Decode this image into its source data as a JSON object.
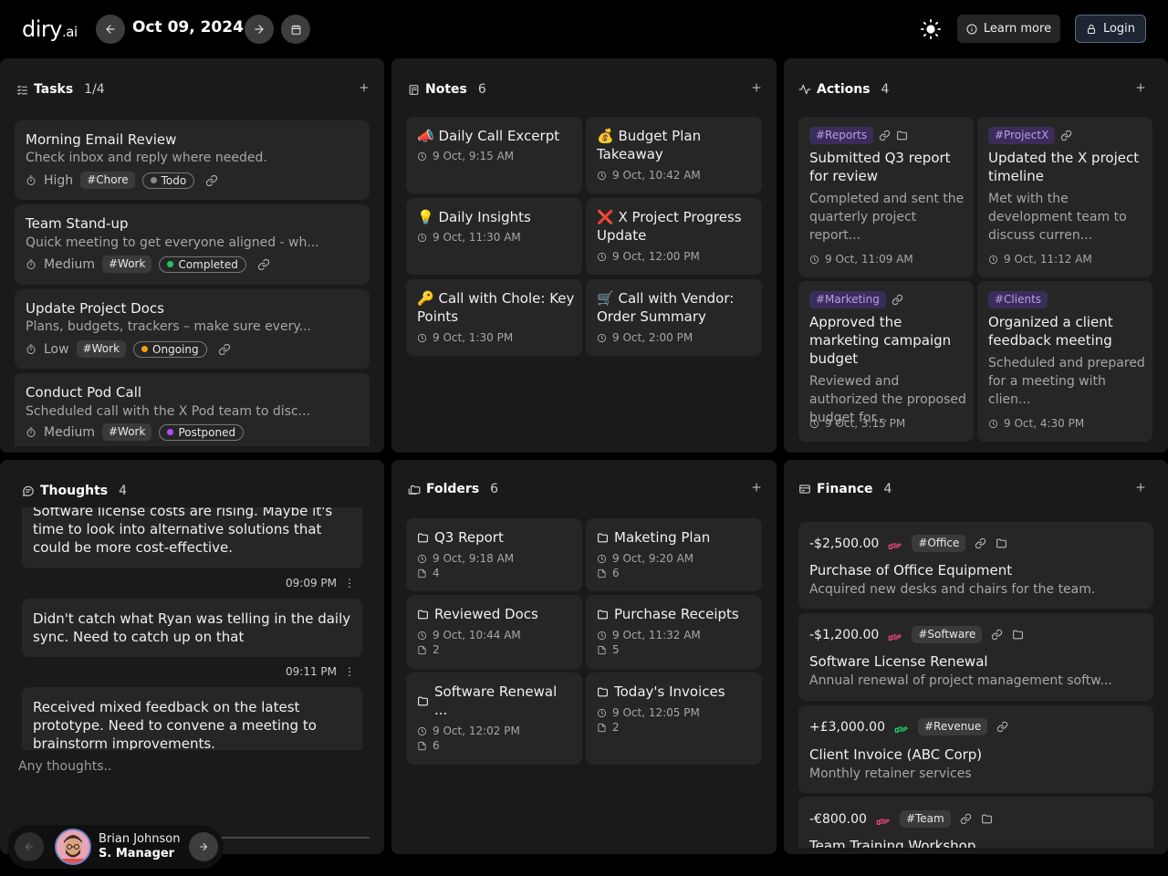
{
  "app": {
    "logo": "diry",
    "logo_suffix": ".ai",
    "date": "Oct 09, 2024",
    "learn_more": "Learn more",
    "login": "Login"
  },
  "tasks": {
    "title": "Tasks",
    "count": "1/4",
    "items": [
      {
        "title": "Morning Email Review",
        "desc": "Check inbox and reply where needed.",
        "priority": "High",
        "tag": "#Chore",
        "status": "Todo",
        "status_color": "#8a8a8a"
      },
      {
        "title": "Team Stand-up",
        "desc": "Quick meeting to get everyone aligned - wh...",
        "priority": "Medium",
        "tag": "#Work",
        "status": "Completed",
        "status_color": "#22c55e"
      },
      {
        "title": "Update Project Docs",
        "desc": "Plans, budgets, trackers – make sure every...",
        "priority": "Low",
        "tag": "#Work",
        "status": "Ongoing",
        "status_color": "#f59e0b"
      },
      {
        "title": "Conduct Pod Call",
        "desc": "Scheduled call with the X Pod team to disc...",
        "priority": "Medium",
        "tag": "#Work",
        "status": "Postponed",
        "status_color": "#a855f7"
      }
    ]
  },
  "notes": {
    "title": "Notes",
    "count": "6",
    "items": [
      {
        "emoji": "📣",
        "title": "Daily Call Excerpt",
        "time": "9 Oct, 9:15 AM"
      },
      {
        "emoji": "💰",
        "title": "Budget Plan Takeaway",
        "time": "9 Oct, 10:42 AM"
      },
      {
        "emoji": "💡",
        "title": "Daily Insights",
        "time": "9 Oct, 11:30 AM"
      },
      {
        "emoji": "❌",
        "title": "X Project Progress Update",
        "time": "9 Oct, 12:00 PM"
      },
      {
        "emoji": "🔑",
        "title": "Call with Chole: Key Points",
        "time": "9 Oct, 1:30 PM"
      },
      {
        "emoji": "🛒",
        "title": "Call with Vendor: Order Summary",
        "time": "9 Oct, 2:00 PM"
      }
    ]
  },
  "actions": {
    "title": "Actions",
    "count": "4",
    "items": [
      {
        "tag": "#Reports",
        "title": "Submitted Q3 report for review",
        "desc": "Completed and sent the quarterly project report...",
        "time": "9 Oct, 11:09 AM"
      },
      {
        "tag": "#ProjectX",
        "title": "Updated the X project timeline",
        "desc": "Met with the development team to discuss curren...",
        "time": "9 Oct, 11:12 AM"
      },
      {
        "tag": "#Marketing",
        "title": "Approved the marketing campaign budget",
        "desc": "Reviewed and authorized the proposed budget for...",
        "time": "9 Oct, 3:15 PM"
      },
      {
        "tag": "#Clients",
        "title": "Organized a client feedback meeting",
        "desc": "Scheduled and prepared for a meeting with clien...",
        "time": "9 Oct, 4:30 PM"
      }
    ]
  },
  "thoughts": {
    "title": "Thoughts",
    "count": "4",
    "items": [
      {
        "text": "Software license costs are rising. Maybe it's time to look into alternative solutions that could be more cost-effective.",
        "time": "09:09 PM"
      },
      {
        "text": "Didn't catch what Ryan was telling in the daily sync. Need to catch up on that",
        "time": "09:11 PM"
      },
      {
        "text": "Received mixed feedback on the latest prototype. Need to convene a meeting to brainstorm improvements.",
        "time": ""
      }
    ],
    "placeholder": "Any thoughts.."
  },
  "folders": {
    "title": "Folders",
    "count": "6",
    "items": [
      {
        "name": "Q3 Report",
        "time": "9 Oct, 9:18 AM",
        "files": "4"
      },
      {
        "name": "Maketing Plan",
        "time": "9 Oct, 9:20 AM",
        "files": "6"
      },
      {
        "name": "Reviewed Docs",
        "time": "9 Oct, 10:44 AM",
        "files": "2"
      },
      {
        "name": "Purchase Receipts",
        "time": "9 Oct, 11:32 AM",
        "files": "5"
      },
      {
        "name": "Software Renewal ...",
        "time": "9 Oct, 12:02 PM",
        "files": "6"
      },
      {
        "name": "Today's Invoices",
        "time": "9 Oct, 12:05 PM",
        "files": "2"
      }
    ]
  },
  "finance": {
    "title": "Finance",
    "count": "4",
    "items": [
      {
        "amount": "-$2,500.00",
        "tag": "#Office",
        "title": "Purchase of Office Equipment",
        "desc": "Acquired new desks and chairs for the team.",
        "color": "#e0457b"
      },
      {
        "amount": "-$1,200.00",
        "tag": "#Software",
        "title": "Software License Renewal",
        "desc": "Annual renewal of project management softw...",
        "color": "#e0457b"
      },
      {
        "amount": "+£3,000.00",
        "tag": "#Revenue",
        "title": "Client Invoice (ABC Corp)",
        "desc": "Monthly retainer services",
        "color": "#22c55e"
      },
      {
        "amount": "-€800.00",
        "tag": "#Team",
        "title": "Team Training Workshop",
        "desc": "",
        "color": "#e0457b"
      }
    ]
  },
  "user": {
    "name": "Brian Johnson",
    "role": "S. Manager"
  }
}
